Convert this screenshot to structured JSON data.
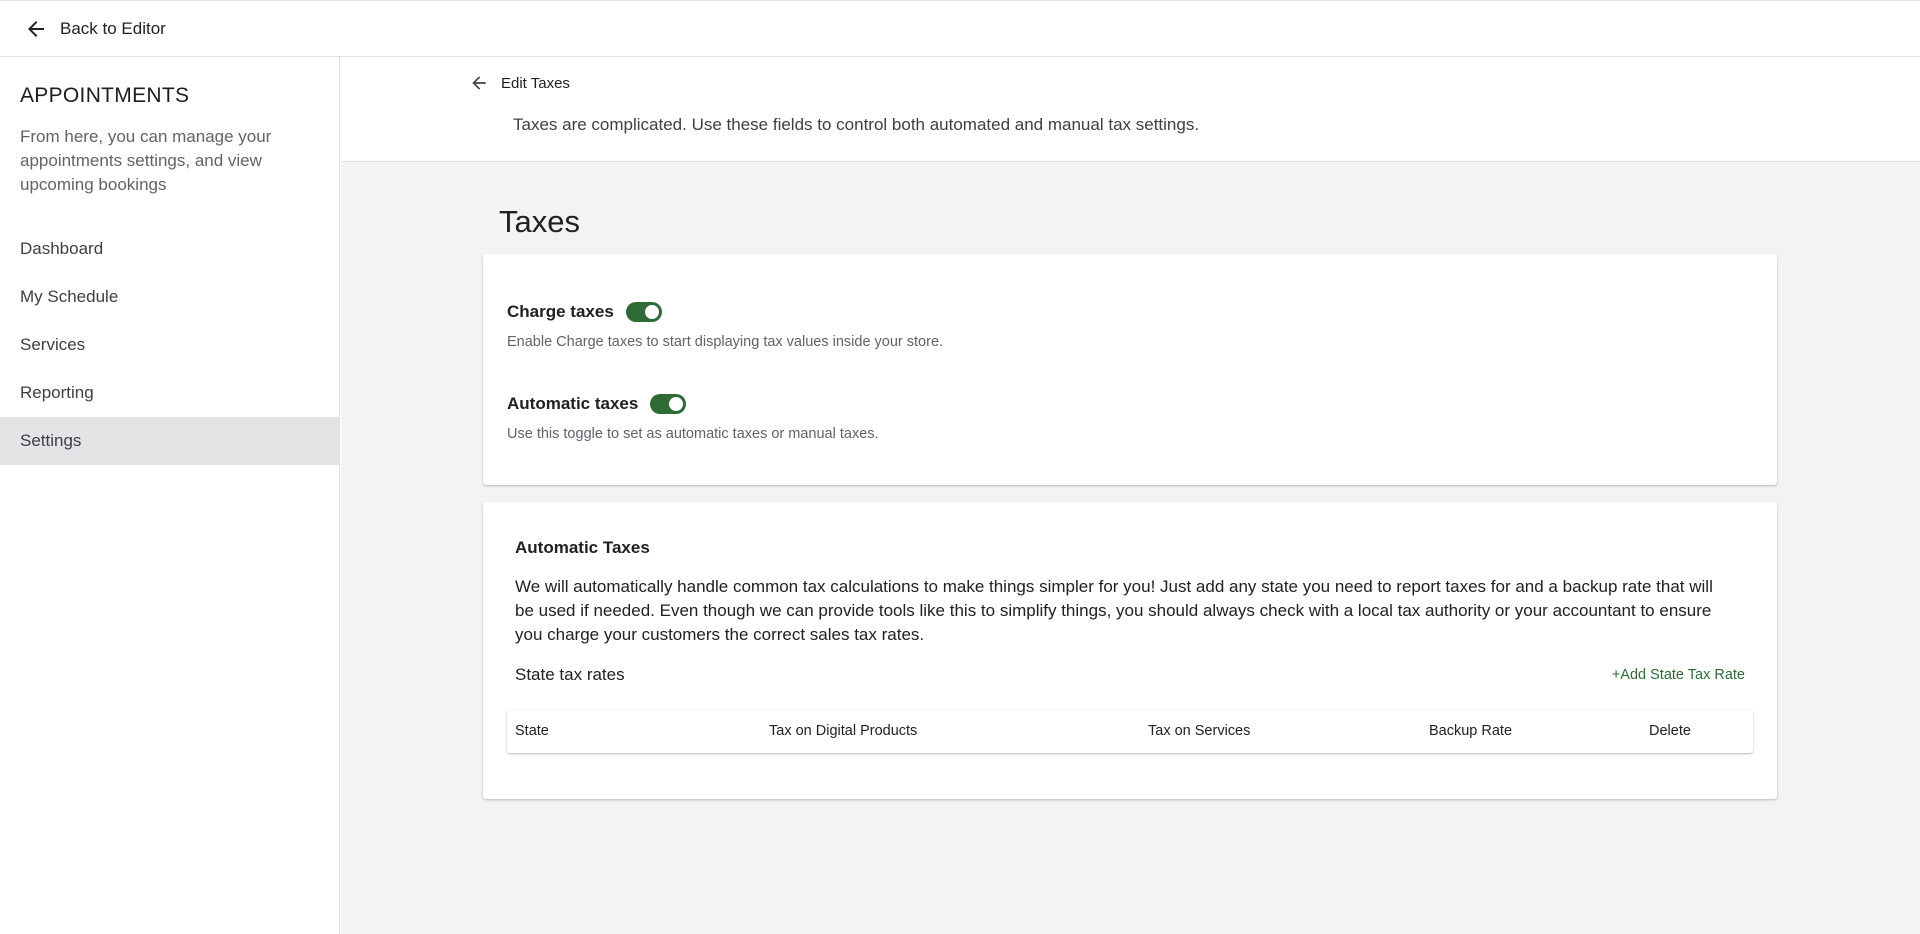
{
  "topbar": {
    "back_label": "Back to Editor"
  },
  "sidebar": {
    "title": "APPOINTMENTS",
    "description": "From here, you can manage your appointments settings, and view upcoming bookings",
    "items": [
      {
        "label": "Dashboard",
        "active": false
      },
      {
        "label": "My Schedule",
        "active": false
      },
      {
        "label": "Services",
        "active": false
      },
      {
        "label": "Reporting",
        "active": false
      },
      {
        "label": "Settings",
        "active": true
      }
    ]
  },
  "header": {
    "back_label": "Edit Taxes",
    "description": "Taxes are complicated. Use these fields to control both automated and manual tax settings."
  },
  "page": {
    "title": "Taxes"
  },
  "settings_card": {
    "charge_taxes": {
      "label": "Charge taxes",
      "enabled": true,
      "help": "Enable Charge taxes to start displaying tax values inside your store."
    },
    "automatic_taxes": {
      "label": "Automatic taxes",
      "enabled": true,
      "help": "Use this toggle to set as automatic taxes or manual taxes."
    }
  },
  "automatic_card": {
    "title": "Automatic Taxes",
    "description": "We will automatically handle common tax calculations to make things simpler for you! Just add any state you need to report taxes for and a backup rate that will be used if needed. Even though we can provide tools like this to simplify things, you should always check with a local tax authority or your accountant to ensure you charge your customers the correct sales tax rates.",
    "rates_label": "State tax rates",
    "add_label": "+Add State Tax Rate",
    "columns": [
      "State",
      "Tax on Digital Products",
      "Tax on Services",
      "Backup Rate",
      "Delete"
    ]
  },
  "colors": {
    "accent": "#2e6b35",
    "page_background": "#f3f3f3",
    "active_nav": "#e4e4e7"
  }
}
